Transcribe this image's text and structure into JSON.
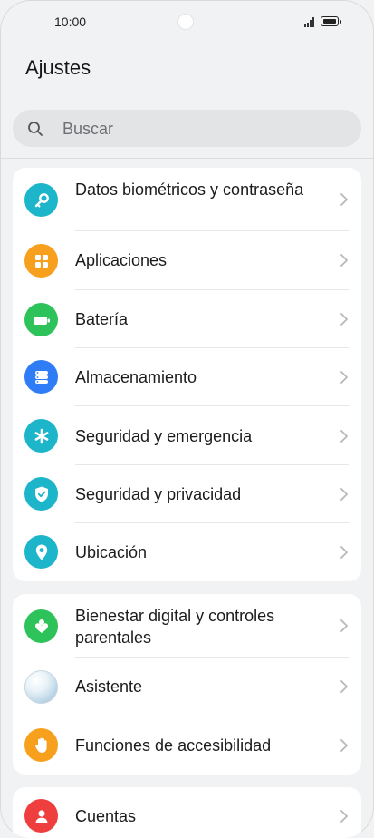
{
  "status_bar": {
    "time": "10:00"
  },
  "header": {
    "title": "Ajustes"
  },
  "search": {
    "placeholder": "Buscar"
  },
  "sections": [
    {
      "items": [
        {
          "label": "Datos biométricos y contraseña",
          "icon": "key-icon",
          "color": "#1cb5c9"
        },
        {
          "label": "Aplicaciones",
          "icon": "apps-grid-icon",
          "color": "#f7a01e"
        },
        {
          "label": "Batería",
          "icon": "battery-icon",
          "color": "#2ec25b"
        },
        {
          "label": "Almacenamiento",
          "icon": "storage-icon",
          "color": "#2e7df6"
        },
        {
          "label": "Seguridad y emergencia",
          "icon": "asterisk-icon",
          "color": "#1cb5c9"
        },
        {
          "label": "Seguridad y privacidad",
          "icon": "shield-icon",
          "color": "#1cb5c9"
        },
        {
          "label": "Ubicación",
          "icon": "location-pin-icon",
          "color": "#1cb5c9"
        }
      ]
    },
    {
      "items": [
        {
          "label": "Bienestar digital y controles parentales",
          "icon": "wellbeing-icon",
          "color": "#2ec25b"
        },
        {
          "label": "Asistente",
          "icon": "assistant-orb-icon",
          "color": "#cfe3f0"
        },
        {
          "label": "Funciones de accesibilidad",
          "icon": "hand-icon",
          "color": "#f7a01e"
        }
      ]
    },
    {
      "items": [
        {
          "label": "Cuentas",
          "icon": "account-icon",
          "color": "#ee3e3e"
        }
      ]
    }
  ]
}
